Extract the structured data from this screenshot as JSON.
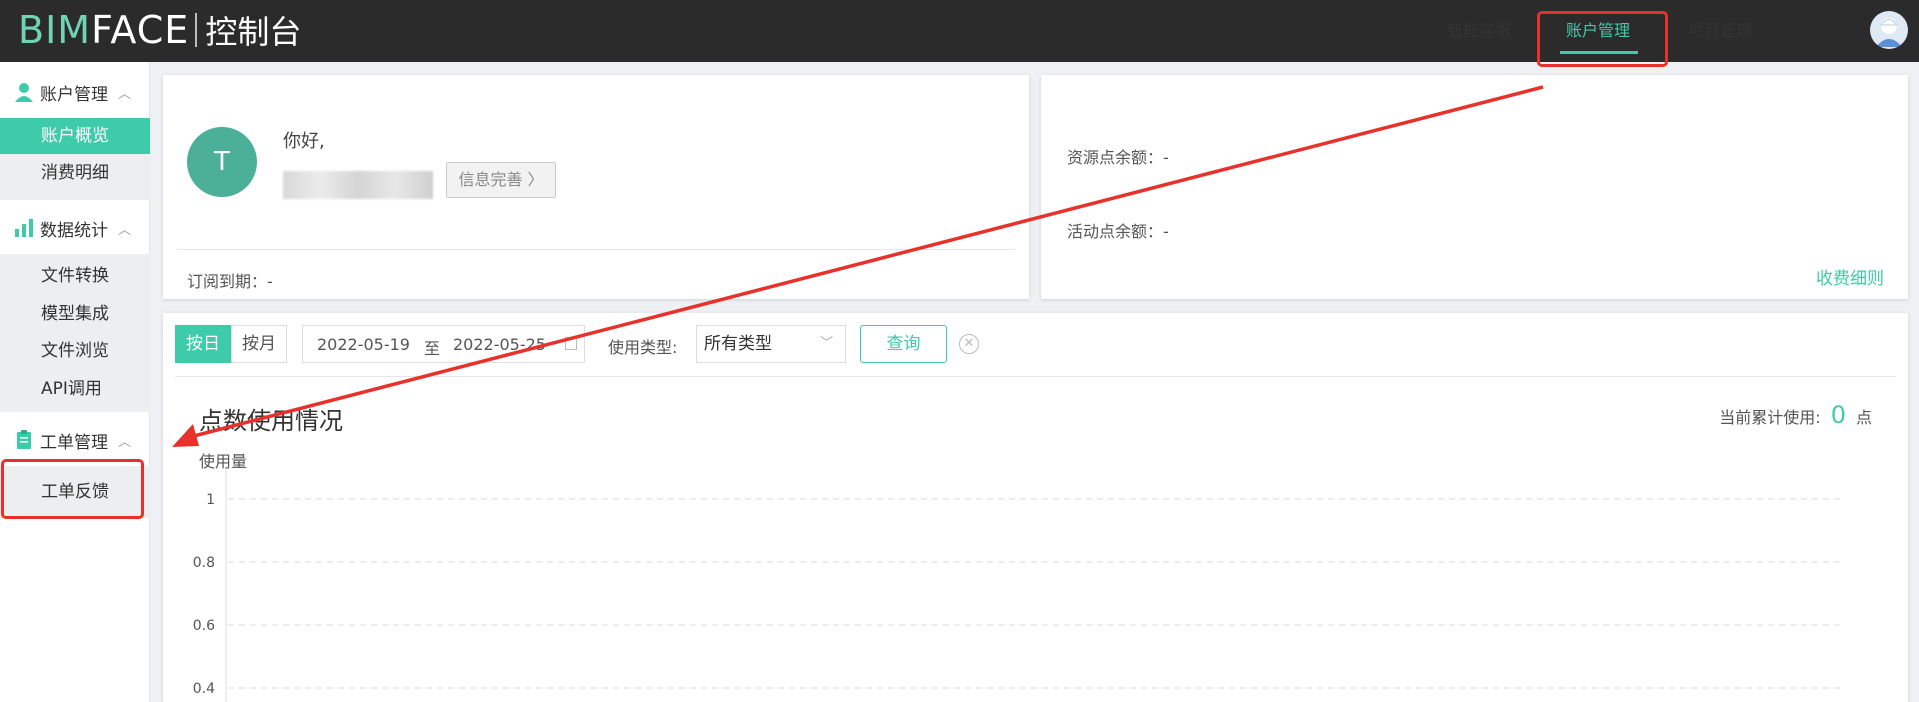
{
  "header": {
    "logo_bim": "BIM",
    "logo_face": "FACE",
    "logo_sub": "控制台",
    "nav": [
      "智能客服",
      "账户管理",
      "项目管理"
    ],
    "active_nav": "账户管理",
    "accent_color": "#3ecbaa"
  },
  "sidebar": {
    "groups": [
      {
        "title": "账户管理",
        "icon": "user-icon",
        "items": [
          "账户概览",
          "消费明细"
        ]
      },
      {
        "title": "数据统计",
        "icon": "bar-chart-icon",
        "items": [
          "文件转换",
          "模型集成",
          "文件浏览",
          "API调用"
        ]
      },
      {
        "title": "工单管理",
        "icon": "clipboard-icon",
        "items": [
          "工单反馈"
        ]
      }
    ],
    "active_item": "账户概览"
  },
  "user_card": {
    "avatar_letter": "T",
    "greeting": "你好,",
    "info_button": "信息完善 〉",
    "subscription_label": "订阅到期：",
    "subscription_value": "-"
  },
  "resource_card": {
    "resource_label": "资源点余额：",
    "resource_value": "-",
    "activity_label": "活动点余额：",
    "activity_value": "-",
    "fee_link": "收费细则"
  },
  "filter": {
    "day_button": "按日",
    "month_button": "按月",
    "start_date": "2022-05-19",
    "date_sep": "至",
    "end_date": "2022-05-25",
    "type_label": "使用类型:",
    "type_value": "所有类型",
    "query_button": "查询"
  },
  "usage": {
    "title": "点数使用情况",
    "cumulative_label": "当前累计使用:",
    "cumulative_value": "0",
    "cumulative_unit": "点"
  },
  "chart_data": {
    "type": "line",
    "ylabel": "使用量",
    "yticks": [
      "1",
      "0.8",
      "0.6",
      "0.4"
    ],
    "ylim": [
      0.4,
      1
    ],
    "grid": true,
    "series": []
  }
}
